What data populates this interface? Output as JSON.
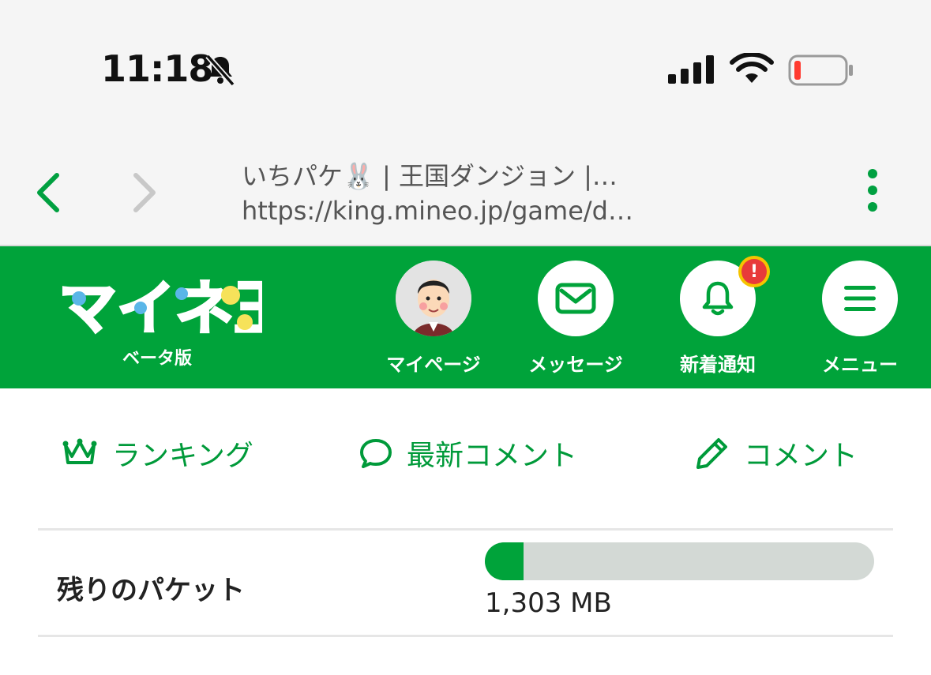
{
  "status_bar": {
    "time": "11:18",
    "battery_low_color": "#ff3b30"
  },
  "browser": {
    "page_title": "いちパケ🐰 | 王国ダンジョン |…",
    "url": "https://king.mineo.jp/game/d…"
  },
  "header": {
    "logo_text": "マイネ王",
    "logo_subtitle": "ベータ版",
    "brand_color": "#00a33a",
    "buttons": [
      {
        "label": "マイページ",
        "icon": "avatar"
      },
      {
        "label": "メッセージ",
        "icon": "mail-icon"
      },
      {
        "label": "新着通知",
        "icon": "bell-icon",
        "badge": "!"
      },
      {
        "label": "メニュー",
        "icon": "hamburger-icon"
      }
    ]
  },
  "subnav": {
    "items": [
      {
        "label": "ランキング",
        "icon": "crown-icon"
      },
      {
        "label": "最新コメント",
        "icon": "speech-bubble-icon"
      },
      {
        "label": "コメント",
        "icon": "pencil-icon"
      }
    ]
  },
  "packet": {
    "label": "残りのパケット",
    "value_text": "1,303 MB",
    "fill_fraction": 0.1
  }
}
